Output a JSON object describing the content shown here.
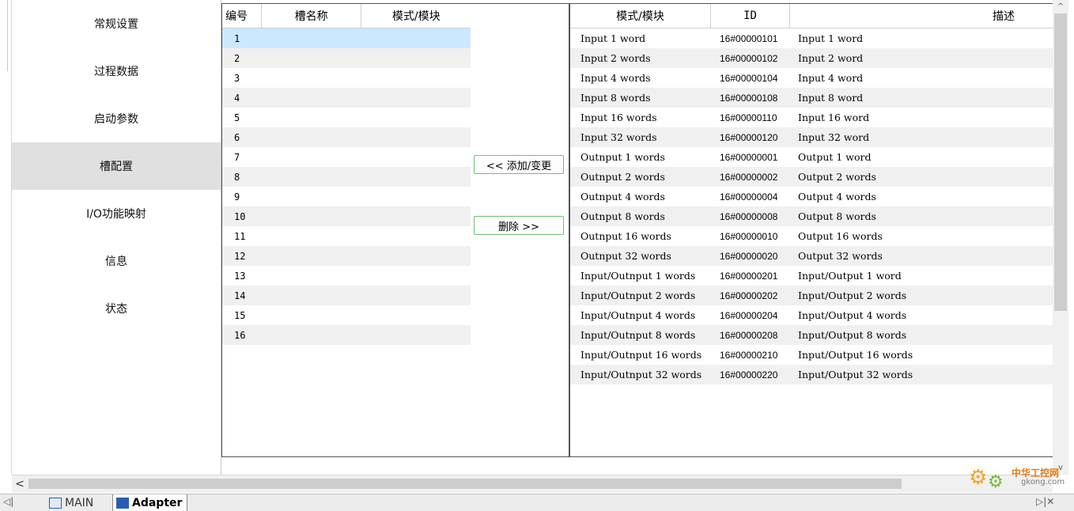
{
  "sidebar": {
    "items": [
      {
        "label": "常规设置"
      },
      {
        "label": "过程数据"
      },
      {
        "label": "启动参数"
      },
      {
        "label": "槽配置"
      },
      {
        "label": "I/O功能映射"
      },
      {
        "label": "信息"
      },
      {
        "label": "状态"
      }
    ],
    "active_index": 3
  },
  "slot_table": {
    "headers": {
      "num": "编号",
      "name": "槽名称",
      "module": "模式/模块"
    },
    "rows": [
      "1",
      "2",
      "3",
      "4",
      "5",
      "6",
      "7",
      "8",
      "9",
      "10",
      "11",
      "12",
      "13",
      "14",
      "15",
      "16"
    ],
    "selected_row": "1"
  },
  "buttons": {
    "add": "<< 添加/变更",
    "delete": "删除 >>"
  },
  "module_table": {
    "headers": {
      "module": "模式/模块",
      "id": "ID",
      "desc": "描述"
    },
    "rows": [
      {
        "module": "Input 1 word",
        "id": "16#00000101",
        "desc": "Input 1 word"
      },
      {
        "module": "Input 2 words",
        "id": "16#00000102",
        "desc": "Input 2 word"
      },
      {
        "module": "Input 4 words",
        "id": "16#00000104",
        "desc": "Input 4 word"
      },
      {
        "module": "Input 8 words",
        "id": "16#00000108",
        "desc": "Input 8 word"
      },
      {
        "module": "Input 16 words",
        "id": "16#00000110",
        "desc": "Input 16 word"
      },
      {
        "module": "Input 32 words",
        "id": "16#00000120",
        "desc": "Input 32 word"
      },
      {
        "module": "Outnput 1 words",
        "id": "16#00000001",
        "desc": "Output 1 word"
      },
      {
        "module": "Outnput 2 words",
        "id": "16#00000002",
        "desc": "Output 2 words"
      },
      {
        "module": "Outnput 4 words",
        "id": "16#00000004",
        "desc": "Output 4 words"
      },
      {
        "module": "Outnput 8 words",
        "id": "16#00000008",
        "desc": "Output 8 words"
      },
      {
        "module": "Outnput 16 words",
        "id": "16#00000010",
        "desc": "Output 16 words"
      },
      {
        "module": "Outnput 32 words",
        "id": "16#00000020",
        "desc": "Output 32 words"
      },
      {
        "module": "Input/Outnput 1 words",
        "id": "16#00000201",
        "desc": "Input/Output 1 word"
      },
      {
        "module": "Input/Outnput 2 words",
        "id": "16#00000202",
        "desc": "Input/Output 2 words"
      },
      {
        "module": "Input/Outnput 4 words",
        "id": "16#00000204",
        "desc": "Input/Output 4 words"
      },
      {
        "module": "Input/Outnput 8 words",
        "id": "16#00000208",
        "desc": "Input/Output 8 words"
      },
      {
        "module": "Input/Outnput 16 words",
        "id": "16#00000210",
        "desc": "Input/Output 16 words"
      },
      {
        "module": "Input/Outnput 32 words",
        "id": "16#00000220",
        "desc": "Input/Output 32 words"
      }
    ]
  },
  "scroll": {
    "left_arrow": "<",
    "up_arrow": "^",
    "down_arrow": "v"
  },
  "tabs": [
    {
      "label": "MAIN",
      "icon": "document-icon"
    },
    {
      "label": "Adapter",
      "icon": "device-icon",
      "active": true
    }
  ],
  "tabbar_nav": {
    "left": "◁|",
    "right": "▷|✕"
  },
  "watermark": {
    "line1": "中华工控网",
    "line2": "gkong.com"
  },
  "colors": {
    "selected_row": "#cce8ff",
    "active_nav": "#e0e0e0",
    "button_border": "#6fbf73"
  }
}
